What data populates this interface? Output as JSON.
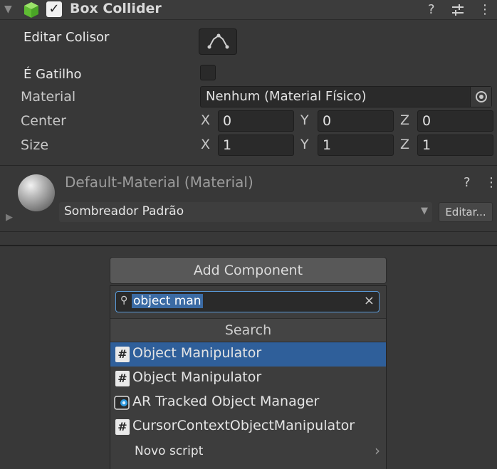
{
  "component": {
    "title": "Box Collider",
    "icons": [
      "foldout-arrow",
      "box-collider-icon",
      "enabled-checkbox",
      "help-icon",
      "presets-icon",
      "menu-icon"
    ]
  },
  "properties": {
    "edit_collider_label": "Editar Colisor",
    "is_trigger_label": "É Gatilho",
    "is_trigger_checked": false,
    "material_label": "Material",
    "material_value": "Nenhum (Material Físico)",
    "center_label": "Center",
    "center": {
      "x_label": "X",
      "x": "0",
      "y_label": "Y",
      "y": "0",
      "z_label": "Z",
      "z": "0"
    },
    "size_label": "Size",
    "size": {
      "x_label": "X",
      "x": "1",
      "y_label": "Y",
      "y": "1",
      "z_label": "Z",
      "z": "1"
    }
  },
  "material_block": {
    "title": "Default-Material (Material)",
    "shader_value": "Sombreador Padrão",
    "edit_label": "Editar..."
  },
  "add_component": {
    "button_label": "Add Component",
    "search_value": "object man",
    "search_header": "Search",
    "results": [
      {
        "label": "Object Manipulator",
        "icon": "script-hash-icon",
        "selected": true
      },
      {
        "label": "Object Manipulator",
        "icon": "script-hash-icon",
        "selected": false
      },
      {
        "label": "AR Tracked Object Manager",
        "icon": "ar-component-icon",
        "selected": false
      },
      {
        "label": "CursorContextObjectManipulator",
        "icon": "script-hash-icon",
        "selected": false
      }
    ],
    "new_script_label": "Novo script"
  },
  "colors": {
    "background": "#383838",
    "selection": "#2f5f9a",
    "search_focus": "#5a9ad8",
    "box_collider_green": "#7ad24a"
  }
}
